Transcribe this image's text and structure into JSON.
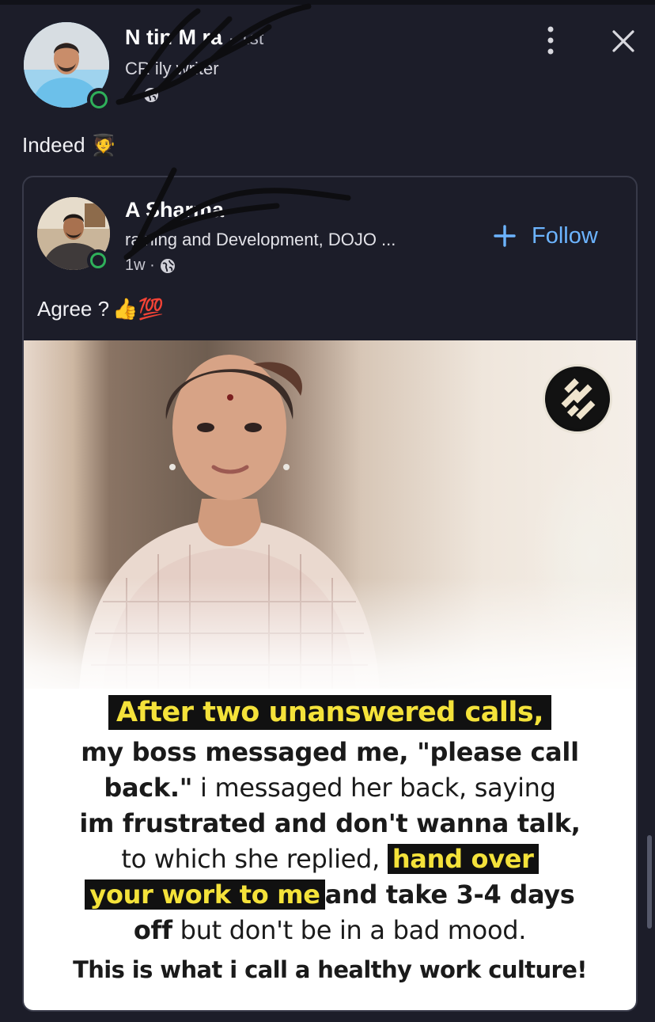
{
  "author": {
    "name_visible": "N tin M  ra",
    "degree": "· 1st",
    "headline_visible": "CR      ily  writer",
    "meta_visible": "..."
  },
  "post": {
    "text": "Indeed",
    "emoji": "🧑‍🎓"
  },
  "shared": {
    "author_name_visible": "A    Sharma",
    "headline_visible": "raining and Development, DOJO ...",
    "meta": "1w ·",
    "follow_label": "Follow",
    "text": "Agree ?",
    "emoji": "👍💯"
  },
  "image_caption": {
    "headline": "After two unanswered calls,",
    "line1": "my boss messaged me, \"please call",
    "line2_bold": "back.\"",
    "line2_rest": " i messaged her back, saying",
    "line3": "im frustrated and don't wanna talk,",
    "line4_pre": "to which she replied, ",
    "line4_hl": "hand over",
    "line5_hl": "your work to me",
    "line5_rest": "and take 3-4 days",
    "line6_bold": "off",
    "line6_rest": " but don't be in a bad mood.",
    "footer": "This is what i call a healthy work culture!"
  },
  "colors": {
    "background": "#1c1d29",
    "link_blue": "#6cb4ff",
    "online_green": "#2fb05a",
    "highlight_yellow": "#f4e23a"
  }
}
